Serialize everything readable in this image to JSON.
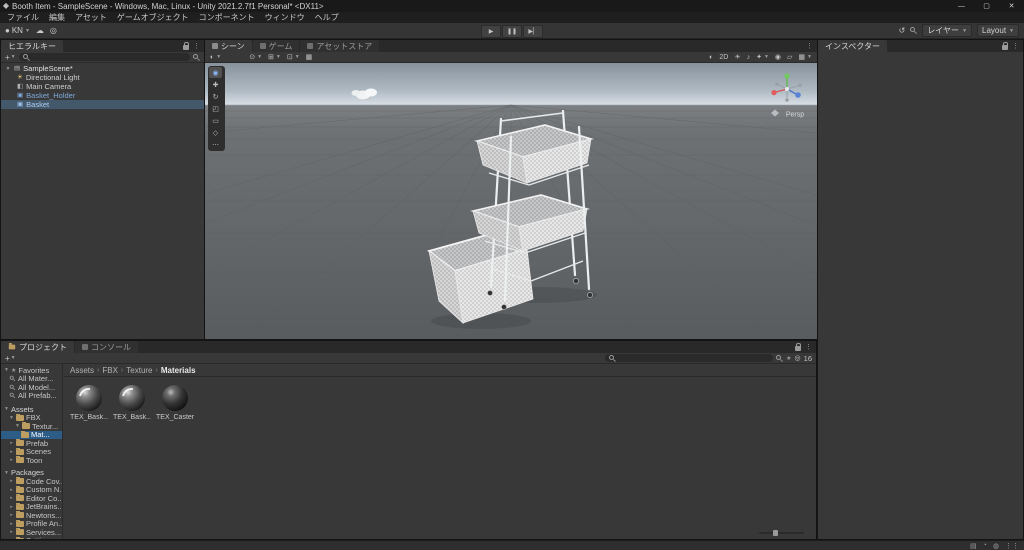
{
  "window": {
    "title": "Booth Item - SampleScene - Windows, Mac, Linux - Unity 2021.2.7f1 Personal* <DX11>",
    "minimize": "—",
    "maximize": "▢",
    "close": "✕"
  },
  "menu": {
    "items": [
      "ファイル",
      "編集",
      "アセット",
      "ゲームオブジェクト",
      "コンポーネント",
      "ウィンドウ",
      "ヘルプ"
    ]
  },
  "toolbar": {
    "account": "KN",
    "layers": "レイヤー",
    "layout": "Layout"
  },
  "hierarchy": {
    "tab": "ヒエラルキー",
    "scene": "SampleScene*",
    "items": [
      {
        "label": "Directional Light"
      },
      {
        "label": "Main Camera"
      },
      {
        "label": "Basket_Holder"
      },
      {
        "label": "Basket"
      }
    ]
  },
  "scene_view": {
    "tabs": [
      "シーン",
      "ゲーム",
      "アセットストア"
    ],
    "toggle_2d": "2D",
    "projection": "Persp"
  },
  "inspector": {
    "tab": "インスペクター"
  },
  "project": {
    "tab": "プロジェクト",
    "console_tab": "コンソール",
    "favorites_label": "Favorites",
    "favorites": [
      "All Mater...",
      "All Model...",
      "All Prefab..."
    ],
    "assets_label": "Assets",
    "tree": [
      "FBX",
      "Textur...",
      "Mat...",
      "Prefab",
      "Scenes",
      "Toon"
    ],
    "packages_label": "Packages",
    "packages": [
      "Code Cov...",
      "Custom N...",
      "Editor Co...",
      "JetBrains...",
      "Newtons...",
      "Profile An...",
      "Services...",
      "Settin..."
    ],
    "breadcrumb": [
      "Assets",
      "FBX",
      "Texture",
      "Materials"
    ],
    "count_badge": "16",
    "items": [
      {
        "label": "TEX_Bask..."
      },
      {
        "label": "TEX_Bask..."
      },
      {
        "label": "TEX_Caster"
      }
    ]
  },
  "colors": {
    "selection": "#2d5c87",
    "prefab_text": "#7faadc",
    "accent": "#4e8ff0",
    "folder": "#bd9e60"
  }
}
